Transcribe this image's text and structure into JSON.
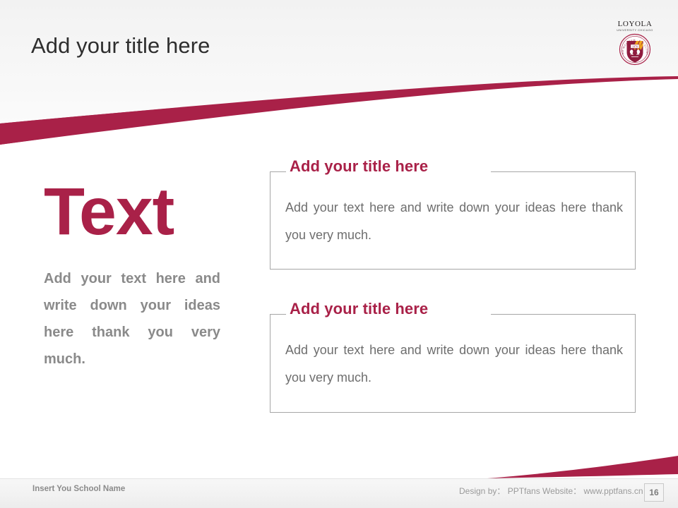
{
  "slide": {
    "page_number": "16",
    "accent_color": "#a92148",
    "title_color": "#2e2e2e",
    "body_gray": "#8a8a8a",
    "box_border_color": "#a6a6a6"
  },
  "header": {
    "title": "Add your title here"
  },
  "logo": {
    "name": "loyola-university-chicago-crest",
    "wordmark": "LOYOLA",
    "subtitle": "UNIVERSITY CHICAGO",
    "crest_year": "1870",
    "crest_motto": "AD MAJOREM DEI GLORIAM"
  },
  "left_column": {
    "headline": "Text",
    "body": "Add your text here and write down your ideas here thank you very much."
  },
  "panels": [
    {
      "heading": "Add your title here",
      "body": "Add your text here and write down your ideas here thank you very much."
    },
    {
      "heading": "Add your title here",
      "body": "Add your text here and write down your ideas here thank you very much."
    }
  ],
  "footer": {
    "school_placeholder": "Insert You School Name",
    "credit": "Design by： PPTfans  Website： www.pptfans.cn"
  }
}
